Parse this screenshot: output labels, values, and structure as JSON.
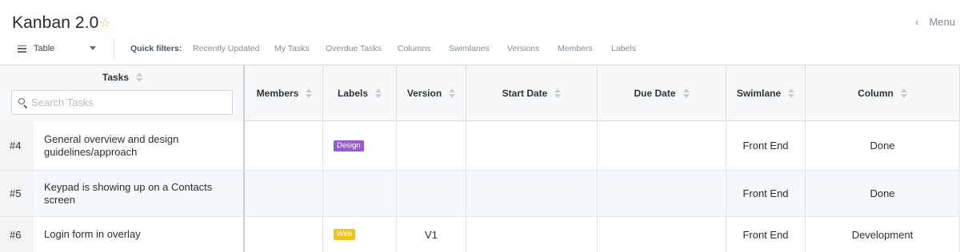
{
  "header": {
    "title": "Kanban 2.0",
    "star_icon": "star-icon",
    "menu_label": "Menu",
    "view_select": {
      "value": "Table"
    },
    "quick_filters_label": "Quick filters:",
    "quick_filters": [
      "Recently Updated",
      "My Tasks",
      "Overdue Tasks",
      "Columns",
      "Swimlanes",
      "Versions",
      "Members",
      "Labels"
    ]
  },
  "table": {
    "tasks_header": "Tasks",
    "search_placeholder": "Search Tasks",
    "columns": [
      "Members",
      "Labels",
      "Version",
      "Start Date",
      "Due Date",
      "Swimlane",
      "Column"
    ],
    "rows": [
      {
        "id": "#4",
        "name": "General overview and design guidelines/approach",
        "members": "",
        "label": "Design",
        "label_color": "#9b59d6",
        "label_text_color": "#ffffff",
        "version": "",
        "start_date": "",
        "due_date": "",
        "swimlane": "Front End",
        "column": "Done"
      },
      {
        "id": "#5",
        "name": "Keypad is showing up on a Contacts screen",
        "members": "",
        "label": "",
        "version": "",
        "start_date": "",
        "due_date": "",
        "swimlane": "Front End",
        "column": "Done"
      },
      {
        "id": "#6",
        "name": "Login form in overlay",
        "members": "",
        "label": "Web",
        "label_color": "#f0c419",
        "label_text_color": "#ffffff",
        "version": "V1",
        "start_date": "",
        "due_date": "",
        "swimlane": "Front End",
        "column": "Development"
      }
    ]
  },
  "colors": {
    "accent_star": "#f3b81f",
    "design_label": "#9b59d6",
    "web_label": "#f0c419",
    "selected_row": "#f4f8fd"
  }
}
